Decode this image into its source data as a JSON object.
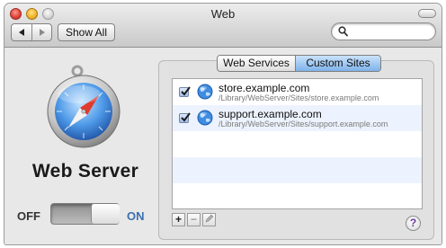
{
  "window": {
    "title": "Web"
  },
  "toolbar": {
    "back_label": "◀",
    "forward_label": "▶",
    "show_all_label": "Show All",
    "search": {
      "placeholder": "",
      "value": ""
    }
  },
  "server": {
    "title": "Web Server",
    "toggle": {
      "off_label": "OFF",
      "on_label": "ON",
      "state": "on"
    }
  },
  "tabs": [
    {
      "label": "Web Services",
      "selected": false
    },
    {
      "label": "Custom Sites",
      "selected": true
    }
  ],
  "sites": [
    {
      "name": "store.example.com",
      "path": "/Library/WebServer/Sites/store.example.com",
      "enabled": true
    },
    {
      "name": "support.example.com",
      "path": "/Library/WebServer/Sites/support.example.com",
      "enabled": true
    }
  ],
  "list_actions": {
    "add": "+",
    "remove": "−",
    "edit_icon": "pencil-icon"
  },
  "help_label": "?",
  "colors": {
    "selected_tab": "#8cbcef",
    "on_label": "#3d6fae",
    "row_alt": "#edf3fe"
  }
}
